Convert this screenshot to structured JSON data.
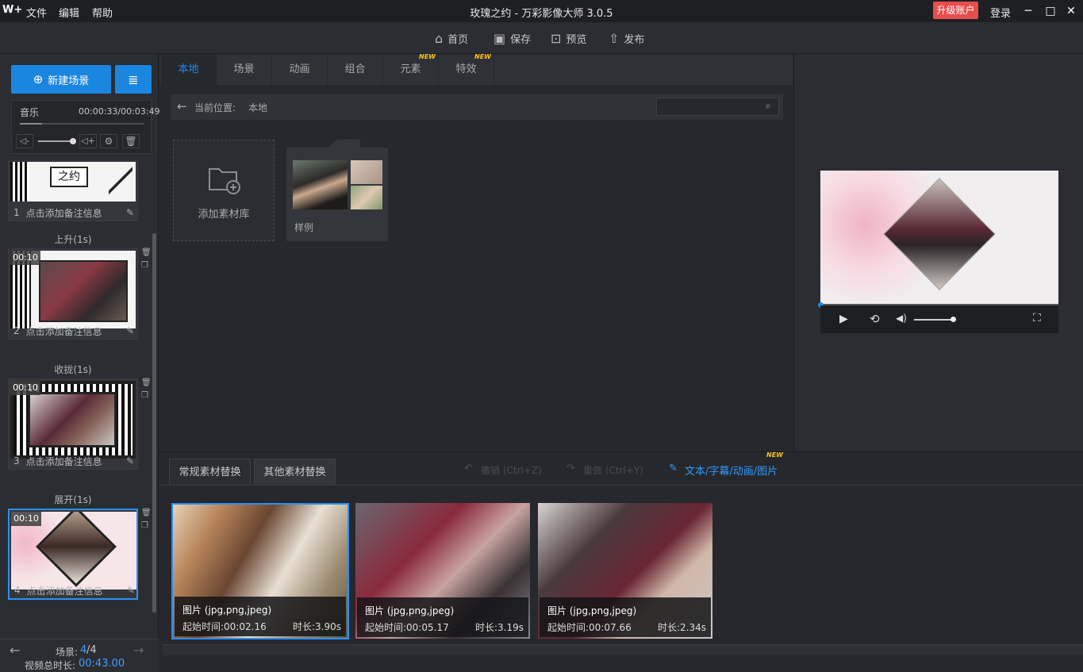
{
  "titlebar": {
    "logo": "W+",
    "menu": [
      "文件",
      "编辑",
      "帮助"
    ],
    "title": "玫瑰之约 - 万彩影像大师 3.0.5",
    "upgrade": "升级账户",
    "login": "登录",
    "win_controls": [
      "─",
      "□",
      "✕"
    ]
  },
  "toolbar": {
    "home": "首页",
    "save": "保存",
    "preview": "预览",
    "publish": "发布"
  },
  "left": {
    "new_scene": "新建场景",
    "music": {
      "label": "音乐",
      "time": "00:00:33/00:03:49"
    },
    "scenes": [
      {
        "index": "1",
        "note": "点击添加备注信息",
        "duration": ""
      },
      {
        "index": "2",
        "note": "点击添加备注信息",
        "duration": "00:10"
      },
      {
        "index": "3",
        "note": "点击添加备注信息",
        "duration": "00:10"
      },
      {
        "index": "4",
        "note": "点击添加备注信息",
        "duration": "00:10"
      }
    ],
    "transitions": [
      "上升(1s)",
      "收拢(1s)",
      "展开(1s)"
    ],
    "footer": {
      "scene_label": "场景:",
      "scene_current": "4",
      "scene_total": "/4",
      "total_label": "视频总时长:",
      "total_time": "00:43.00"
    }
  },
  "center": {
    "tabs": [
      {
        "label": "本地",
        "new": false
      },
      {
        "label": "场景",
        "new": false
      },
      {
        "label": "动画",
        "new": false
      },
      {
        "label": "组合",
        "new": false
      },
      {
        "label": "元素",
        "new": true
      },
      {
        "label": "特效",
        "new": true
      }
    ],
    "new_badge": "NEW",
    "breadcrumb_label": "当前位置:",
    "breadcrumb_value": "本地",
    "search_placeholder": "",
    "add_library": "添加素材库",
    "sample_folder": "样例"
  },
  "bottom": {
    "tabs": [
      "常规素材替换",
      "其他素材替换"
    ],
    "undo": "撤销 (Ctrl+Z)",
    "redo": "重做 (Ctrl+Y)",
    "text_edit": "文本/字幕/动画/图片",
    "assets": [
      {
        "type": "图片 (jpg,png,jpeg)",
        "start": "起始时间:00:02.16",
        "duration": "时长:3.90s"
      },
      {
        "type": "图片 (jpg,png,jpeg)",
        "start": "起始时间:00:05.17",
        "duration": "时长:3.19s"
      },
      {
        "type": "图片 (jpg,png,jpeg)",
        "start": "起始时间:00:07.66",
        "duration": "时长:2.34s"
      }
    ]
  },
  "colors": {
    "accent": "#1b86e0",
    "upgrade": "#e84d4d",
    "new_badge": "#f4c21a"
  }
}
